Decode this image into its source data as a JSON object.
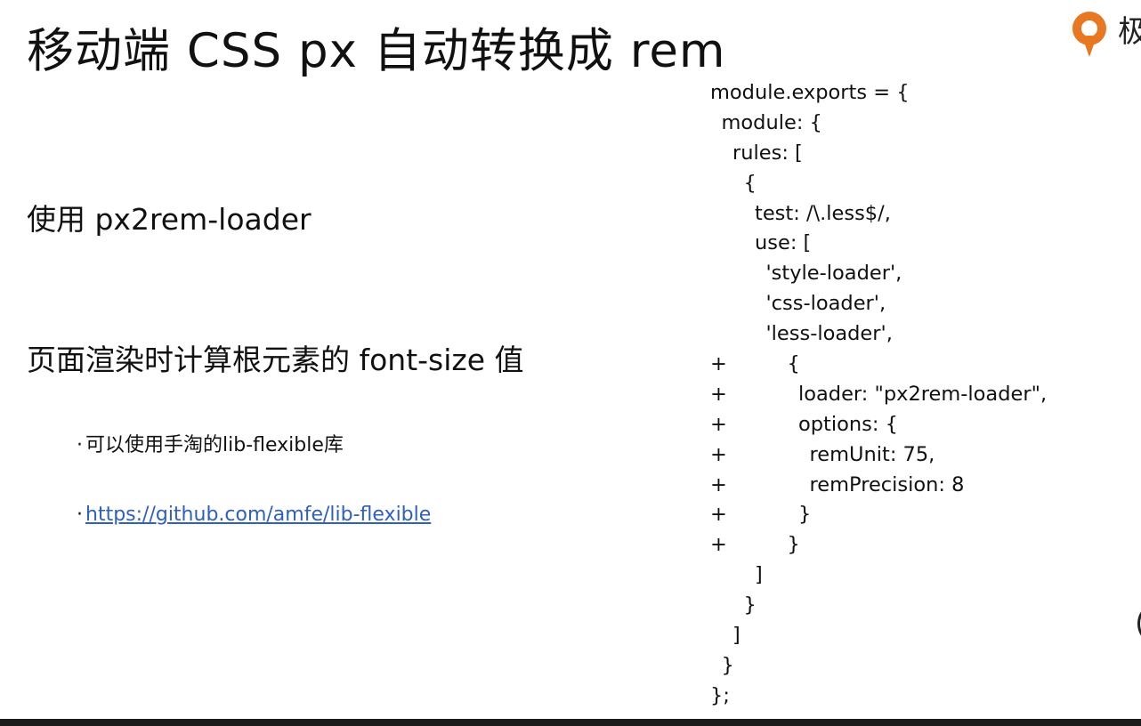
{
  "slide": {
    "title": "移动端 CSS px 自动转换成 rem",
    "logo_text": "极",
    "points": [
      "使用 px2rem-loader",
      "页面渲染时计算根元素的 font-size 值"
    ],
    "sub_points": [
      {
        "bullet": "·",
        "text": "可以使用手淘的lib-flexible库"
      },
      {
        "bullet": "·",
        "link": "https://github.com/amfe/lib-flexible"
      }
    ]
  },
  "code": {
    "lines": [
      {
        "prefix": "",
        "indent": 0,
        "text": "module.exports = {"
      },
      {
        "prefix": "",
        "indent": 1,
        "text": "module: {"
      },
      {
        "prefix": "",
        "indent": 2,
        "text": "rules: ["
      },
      {
        "prefix": "",
        "indent": 3,
        "text": "{"
      },
      {
        "prefix": "",
        "indent": 4,
        "text": "test: /\\.less$/,"
      },
      {
        "prefix": "",
        "indent": 4,
        "text": "use: ["
      },
      {
        "prefix": "",
        "indent": 5,
        "text": "'style-loader',"
      },
      {
        "prefix": "",
        "indent": 5,
        "text": "'css-loader',"
      },
      {
        "prefix": "",
        "indent": 5,
        "text": "'less-loader',"
      },
      {
        "prefix": "+",
        "indent": 5,
        "text": "{"
      },
      {
        "prefix": "+",
        "indent": 6,
        "text": "loader: \"px2rem-loader\","
      },
      {
        "prefix": "+",
        "indent": 6,
        "text": "options: {"
      },
      {
        "prefix": "+",
        "indent": 7,
        "text": "remUnit: 75,"
      },
      {
        "prefix": "+",
        "indent": 7,
        "text": "remPrecision: 8"
      },
      {
        "prefix": "+",
        "indent": 6,
        "text": "}"
      },
      {
        "prefix": "+",
        "indent": 5,
        "text": "}"
      },
      {
        "prefix": "",
        "indent": 4,
        "text": "]"
      },
      {
        "prefix": "",
        "indent": 3,
        "text": "}"
      },
      {
        "prefix": "",
        "indent": 2,
        "text": "]"
      },
      {
        "prefix": "",
        "indent": 1,
        "text": "}"
      },
      {
        "prefix": "",
        "indent": 0,
        "text": "};"
      }
    ]
  },
  "colors": {
    "link": "#2f5fbf",
    "logo_orange": "#e87722",
    "text": "#111111"
  }
}
